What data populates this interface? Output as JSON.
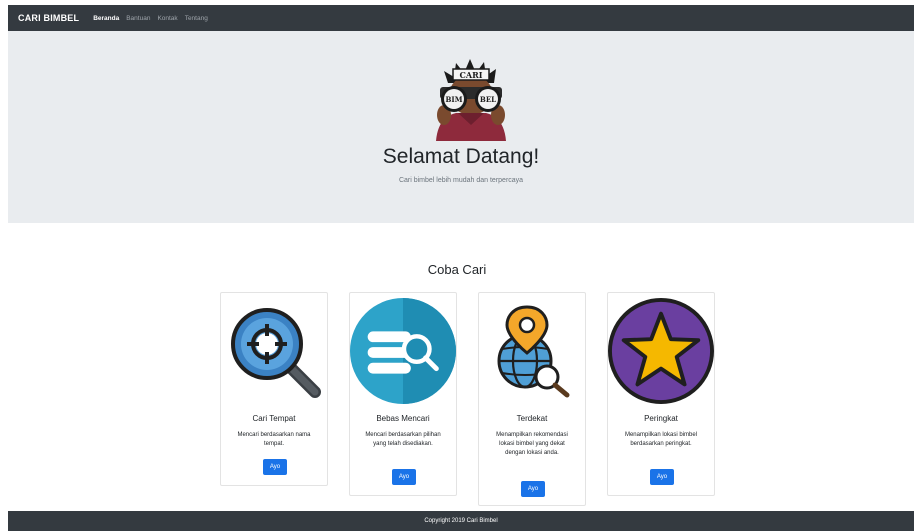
{
  "navbar": {
    "brand": "CARI BIMBEL",
    "links": [
      "Beranda",
      "Bantuan",
      "Kontak",
      "Tentang"
    ]
  },
  "hero": {
    "logo_text_top": "CARI",
    "logo_text_left": "BIM",
    "logo_text_right": "BEL",
    "title": "Selamat Datang!",
    "subtitle": "Cari bimbel lebih mudah dan terpercaya"
  },
  "section": {
    "title": "Coba Cari"
  },
  "cards": [
    {
      "title": "Cari Tempat",
      "text": "Mencari berdasarkan nama tempat.",
      "button": "Ayo",
      "icon": "magnifier-target-icon"
    },
    {
      "title": "Bebas Mencari",
      "text": "Mencari berdasarkan pilihan yang telah disediakan.",
      "button": "Ayo",
      "icon": "list-search-icon"
    },
    {
      "title": "Terdekat",
      "text": "Menampilkan rekomendasi lokasi bimbel yang dekat dengan lokasi anda.",
      "button": "Ayo",
      "icon": "globe-pin-icon"
    },
    {
      "title": "Peringkat",
      "text": "Menampilkan lokasi bimbel berdasarkan peringkat.",
      "button": "Ayo",
      "icon": "star-icon"
    }
  ],
  "footer": {
    "text": "Copyright 2019 Cari Bimbel"
  },
  "colors": {
    "navbar": "#343a40",
    "jumbotron": "#e9ecef",
    "button": "#1a73e8"
  }
}
